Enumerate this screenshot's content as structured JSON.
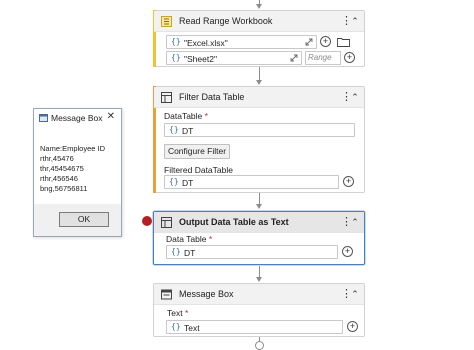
{
  "colors": {
    "accent_read": "#f1c232",
    "accent_filter": "#e6a23c",
    "selection_border": "#4a7ebb",
    "breakpoint": "#b51f24"
  },
  "message_box": {
    "title": "Message Box",
    "lines": [
      "Name:Employee ID",
      "rthr,45476",
      "thr,45454675",
      "rthr,456546",
      "bng,56756811"
    ],
    "ok_label": "OK"
  },
  "read_range": {
    "title": "Read Range Workbook",
    "icon": "excel-workbook-icon",
    "file_value": "\"Excel.xlsx\"",
    "sheet_value": "\"Sheet2\"",
    "range_placeholder": "Range"
  },
  "filter": {
    "title": "Filter Data Table",
    "icon": "data-table-icon",
    "datatable_label": "DataTable",
    "datatable_value": "DT",
    "configure_label": "Configure Filter",
    "filtered_label": "Filtered DataTable",
    "filtered_value": "DT"
  },
  "output": {
    "title": "Output Data Table as Text",
    "icon": "data-table-icon",
    "datatable_label": "Data Table",
    "datatable_value": "DT"
  },
  "msg_activity": {
    "title": "Message Box",
    "icon": "message-box-icon",
    "text_label": "Text",
    "text_value": "Text"
  },
  "common": {
    "required_mark": "*",
    "kebab": "⋮",
    "collapse": "⌃",
    "brace": "{}",
    "plus": "+"
  }
}
